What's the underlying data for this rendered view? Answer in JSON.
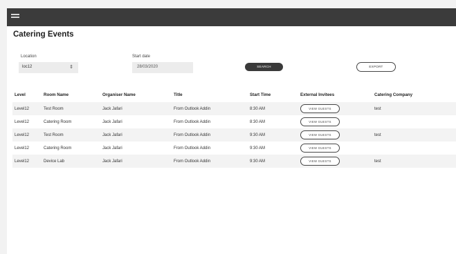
{
  "header": {
    "menu_icon": "hamburger-menu-icon"
  },
  "page": {
    "title": "Catering Events"
  },
  "filters": {
    "location_label": "Location",
    "location_value": "loc12",
    "start_date_label": "Start date",
    "start_date_value": "28/03/2020",
    "search_label": "SEARCH",
    "export_label": "EXPORT"
  },
  "table": {
    "columns": [
      "Level",
      "Room Name",
      "Organiser Name",
      "Title",
      "Start Time",
      "External Invitees",
      "Catering Company"
    ],
    "view_guests_label": "VIEW GUESTS",
    "rows": [
      {
        "level": "Level12",
        "room": "Test Room",
        "organiser": "Jack Jafari",
        "title": "From Outlook Addin",
        "start": "8:30 AM",
        "catering": "test"
      },
      {
        "level": "Level12",
        "room": "Catering Room",
        "organiser": "Jack Jafari",
        "title": "From Outlook Addin",
        "start": "8:30 AM",
        "catering": ""
      },
      {
        "level": "Level12",
        "room": "Test Room",
        "organiser": "Jack Jafari",
        "title": "From Outlook Addin",
        "start": "9:30 AM",
        "catering": "test"
      },
      {
        "level": "Level12",
        "room": "Catering Room",
        "organiser": "Jack Jafari",
        "title": "From Outlook Addin",
        "start": "9:30 AM",
        "catering": ""
      },
      {
        "level": "Level12",
        "room": "Device Lab",
        "organiser": "Jack Jafari",
        "title": "From Outlook Addin",
        "start": "9:30 AM",
        "catering": "test"
      }
    ]
  }
}
